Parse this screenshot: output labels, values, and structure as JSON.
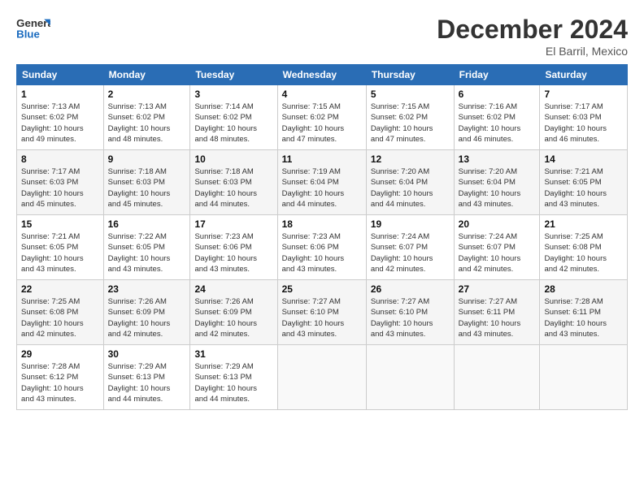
{
  "header": {
    "logo_line1": "General",
    "logo_line2": "Blue",
    "month": "December 2024",
    "location": "El Barril, Mexico"
  },
  "weekdays": [
    "Sunday",
    "Monday",
    "Tuesday",
    "Wednesday",
    "Thursday",
    "Friday",
    "Saturday"
  ],
  "weeks": [
    [
      {
        "day": "1",
        "info": "Sunrise: 7:13 AM\nSunset: 6:02 PM\nDaylight: 10 hours\nand 49 minutes."
      },
      {
        "day": "2",
        "info": "Sunrise: 7:13 AM\nSunset: 6:02 PM\nDaylight: 10 hours\nand 48 minutes."
      },
      {
        "day": "3",
        "info": "Sunrise: 7:14 AM\nSunset: 6:02 PM\nDaylight: 10 hours\nand 48 minutes."
      },
      {
        "day": "4",
        "info": "Sunrise: 7:15 AM\nSunset: 6:02 PM\nDaylight: 10 hours\nand 47 minutes."
      },
      {
        "day": "5",
        "info": "Sunrise: 7:15 AM\nSunset: 6:02 PM\nDaylight: 10 hours\nand 47 minutes."
      },
      {
        "day": "6",
        "info": "Sunrise: 7:16 AM\nSunset: 6:02 PM\nDaylight: 10 hours\nand 46 minutes."
      },
      {
        "day": "7",
        "info": "Sunrise: 7:17 AM\nSunset: 6:03 PM\nDaylight: 10 hours\nand 46 minutes."
      }
    ],
    [
      {
        "day": "8",
        "info": "Sunrise: 7:17 AM\nSunset: 6:03 PM\nDaylight: 10 hours\nand 45 minutes."
      },
      {
        "day": "9",
        "info": "Sunrise: 7:18 AM\nSunset: 6:03 PM\nDaylight: 10 hours\nand 45 minutes."
      },
      {
        "day": "10",
        "info": "Sunrise: 7:18 AM\nSunset: 6:03 PM\nDaylight: 10 hours\nand 44 minutes."
      },
      {
        "day": "11",
        "info": "Sunrise: 7:19 AM\nSunset: 6:04 PM\nDaylight: 10 hours\nand 44 minutes."
      },
      {
        "day": "12",
        "info": "Sunrise: 7:20 AM\nSunset: 6:04 PM\nDaylight: 10 hours\nand 44 minutes."
      },
      {
        "day": "13",
        "info": "Sunrise: 7:20 AM\nSunset: 6:04 PM\nDaylight: 10 hours\nand 43 minutes."
      },
      {
        "day": "14",
        "info": "Sunrise: 7:21 AM\nSunset: 6:05 PM\nDaylight: 10 hours\nand 43 minutes."
      }
    ],
    [
      {
        "day": "15",
        "info": "Sunrise: 7:21 AM\nSunset: 6:05 PM\nDaylight: 10 hours\nand 43 minutes."
      },
      {
        "day": "16",
        "info": "Sunrise: 7:22 AM\nSunset: 6:05 PM\nDaylight: 10 hours\nand 43 minutes."
      },
      {
        "day": "17",
        "info": "Sunrise: 7:23 AM\nSunset: 6:06 PM\nDaylight: 10 hours\nand 43 minutes."
      },
      {
        "day": "18",
        "info": "Sunrise: 7:23 AM\nSunset: 6:06 PM\nDaylight: 10 hours\nand 43 minutes."
      },
      {
        "day": "19",
        "info": "Sunrise: 7:24 AM\nSunset: 6:07 PM\nDaylight: 10 hours\nand 42 minutes."
      },
      {
        "day": "20",
        "info": "Sunrise: 7:24 AM\nSunset: 6:07 PM\nDaylight: 10 hours\nand 42 minutes."
      },
      {
        "day": "21",
        "info": "Sunrise: 7:25 AM\nSunset: 6:08 PM\nDaylight: 10 hours\nand 42 minutes."
      }
    ],
    [
      {
        "day": "22",
        "info": "Sunrise: 7:25 AM\nSunset: 6:08 PM\nDaylight: 10 hours\nand 42 minutes."
      },
      {
        "day": "23",
        "info": "Sunrise: 7:26 AM\nSunset: 6:09 PM\nDaylight: 10 hours\nand 42 minutes."
      },
      {
        "day": "24",
        "info": "Sunrise: 7:26 AM\nSunset: 6:09 PM\nDaylight: 10 hours\nand 42 minutes."
      },
      {
        "day": "25",
        "info": "Sunrise: 7:27 AM\nSunset: 6:10 PM\nDaylight: 10 hours\nand 43 minutes."
      },
      {
        "day": "26",
        "info": "Sunrise: 7:27 AM\nSunset: 6:10 PM\nDaylight: 10 hours\nand 43 minutes."
      },
      {
        "day": "27",
        "info": "Sunrise: 7:27 AM\nSunset: 6:11 PM\nDaylight: 10 hours\nand 43 minutes."
      },
      {
        "day": "28",
        "info": "Sunrise: 7:28 AM\nSunset: 6:11 PM\nDaylight: 10 hours\nand 43 minutes."
      }
    ],
    [
      {
        "day": "29",
        "info": "Sunrise: 7:28 AM\nSunset: 6:12 PM\nDaylight: 10 hours\nand 43 minutes."
      },
      {
        "day": "30",
        "info": "Sunrise: 7:29 AM\nSunset: 6:13 PM\nDaylight: 10 hours\nand 44 minutes."
      },
      {
        "day": "31",
        "info": "Sunrise: 7:29 AM\nSunset: 6:13 PM\nDaylight: 10 hours\nand 44 minutes."
      },
      null,
      null,
      null,
      null
    ]
  ]
}
